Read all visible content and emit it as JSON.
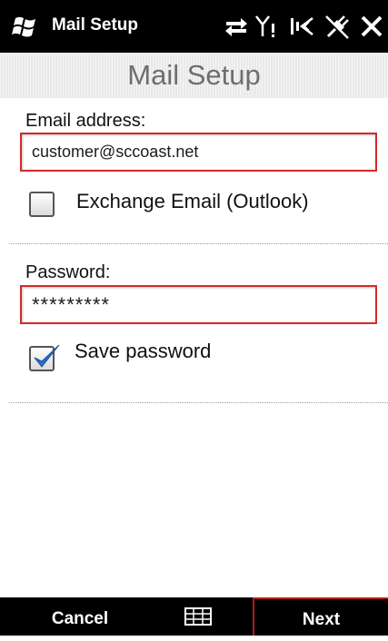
{
  "status_bar": {
    "title": "Mail Setup",
    "icons": [
      "windows-logo",
      "data-sync-icon",
      "signal-icon",
      "volume-icon",
      "connection-icon",
      "close-icon"
    ]
  },
  "header": {
    "title": "Mail Setup"
  },
  "form": {
    "email_label": "Email address:",
    "email_value": "customer@sccoast.net",
    "exchange_label": "Exchange Email (Outlook)",
    "exchange_checked": false,
    "password_label": "Password:",
    "password_value": "*********",
    "save_password_label": "Save password",
    "save_password_checked": true
  },
  "softkeys": {
    "left": "Cancel",
    "center_icon": "keyboard-icon",
    "right": "Next"
  },
  "colors": {
    "focus_border": "#d42a2a",
    "check_mark": "#2a6fc9",
    "bar_background": "#000000"
  }
}
